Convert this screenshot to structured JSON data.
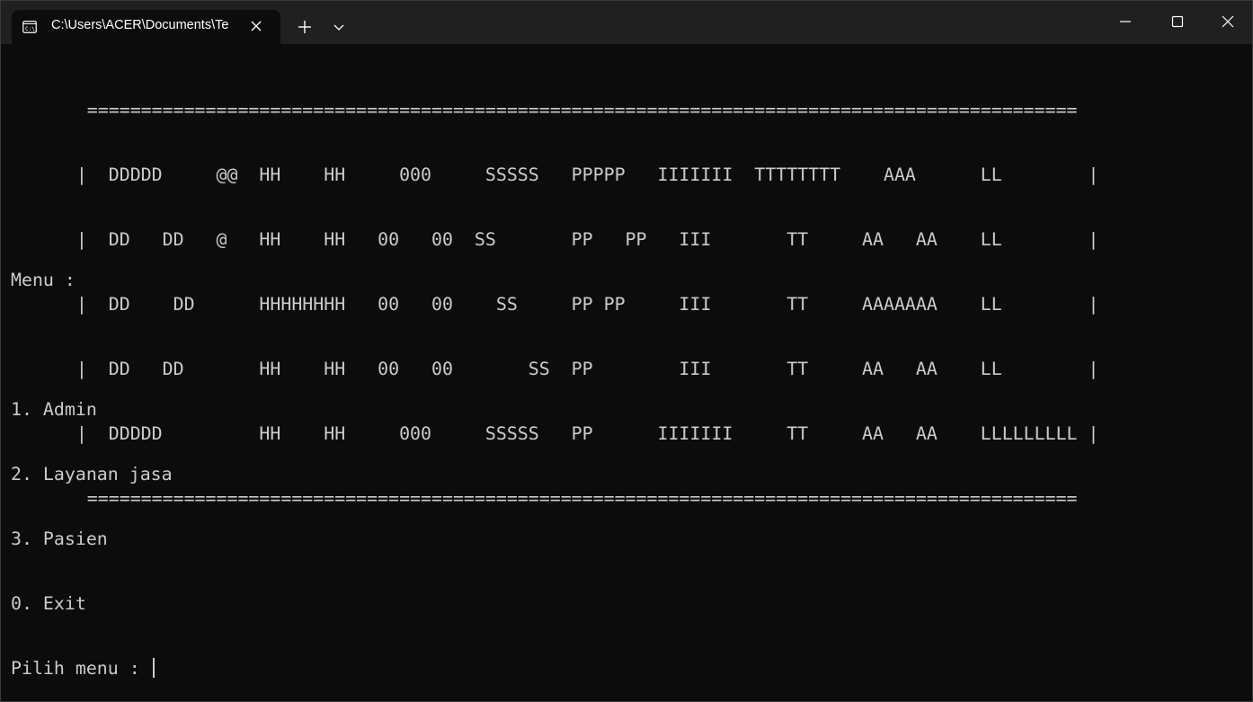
{
  "window": {
    "tab_title": "C:\\Users\\ACER\\Documents\\Te",
    "tab_icon": "terminal-icon",
    "new_tab_icon": "plus-icon",
    "dropdown_icon": "chevron-down-icon",
    "controls": [
      "minimize-icon",
      "maximize-icon",
      "close-icon"
    ]
  },
  "console": {
    "banner": [
      "        ============================================================================================",
      "       |  DDDDD     @@  HH    HH     000     SSSSS   PPPPP   IIIIIII  TTTTTTTT    AAA      LL        |",
      "       |  DD   DD   @   HH    HH   00   00  SS       PP   PP   III       TT     AA   AA    LL        |",
      "       |  DD    DD      HHHHHHHH   00   00    SS     PP PP     III       TT     AAAAAAA    LL        |",
      "       |  DD   DD       HH    HH   00   00       SS  PP        III       TT     AA   AA    LL        |",
      "       |  DDDDD         HH    HH     000     SSSSS   PP      IIIIIII     TT     AA   AA    LLLLLLLLL |",
      "        ============================================================================================"
    ],
    "menu_heading": "Menu :",
    "menu_items": [
      "1. Admin",
      "2. Layanan jasa",
      "3. Pasien",
      "0. Exit"
    ],
    "prompt": "Pilih menu : ",
    "input_value": ""
  },
  "colors": {
    "background": "#0c0c0c",
    "titlebar": "#202020",
    "text": "#cccccc"
  }
}
